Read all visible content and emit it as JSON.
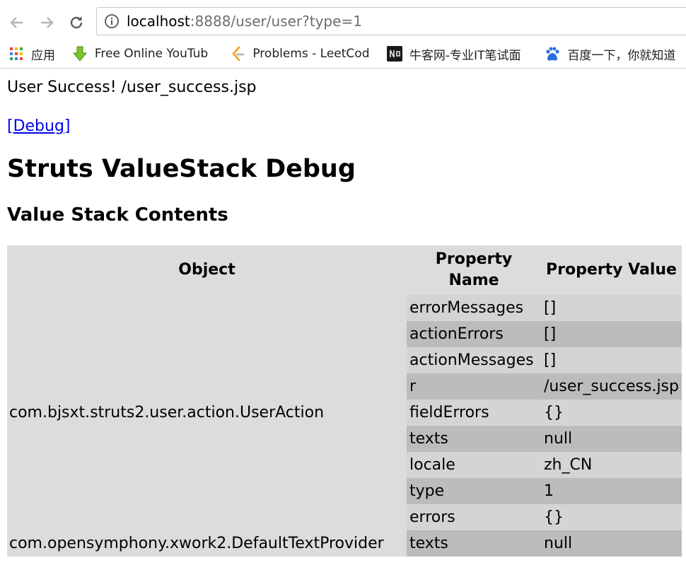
{
  "browser": {
    "url_host": "localhost",
    "url_rest": ":8888/user/user?type=1",
    "back_icon": "arrow-left-icon",
    "forward_icon": "arrow-right-icon",
    "reload_icon": "reload-icon",
    "info_icon": "info-circle-icon",
    "bookmarks": [
      {
        "label": "应用",
        "icon": "apps-grid-icon"
      },
      {
        "label": "Free Online YouTub",
        "icon": "download-arrow-icon"
      },
      {
        "label": "Problems - LeetCod",
        "icon": "leetcode-icon"
      },
      {
        "label": "牛客网-专业IT笔试面",
        "icon": "nowcoder-icon"
      },
      {
        "label": "百度一下，你就知道",
        "icon": "baidu-paw-icon"
      }
    ]
  },
  "page": {
    "message": "User Success! /user_success.jsp",
    "debug_link": "[Debug]",
    "title": "Struts ValueStack Debug",
    "subtitle": "Value Stack Contents",
    "table": {
      "headers": {
        "object": "Object",
        "property_name": "Property Name",
        "property_value": "Property Value"
      },
      "objects": [
        {
          "name": "com.bjsxt.struts2.user.action.UserAction",
          "rows": [
            {
              "name": "errorMessages",
              "value": "[]"
            },
            {
              "name": "actionErrors",
              "value": "[]"
            },
            {
              "name": "actionMessages",
              "value": "[]"
            },
            {
              "name": "r",
              "value": "/user_success.jsp"
            },
            {
              "name": "fieldErrors",
              "value": "{}"
            },
            {
              "name": "texts",
              "value": "null"
            },
            {
              "name": "locale",
              "value": "zh_CN"
            },
            {
              "name": "type",
              "value": "1"
            },
            {
              "name": "errors",
              "value": "{}"
            }
          ]
        },
        {
          "name": "com.opensymphony.xwork2.DefaultTextProvider",
          "rows": [
            {
              "name": "texts",
              "value": "null"
            }
          ]
        }
      ]
    }
  }
}
